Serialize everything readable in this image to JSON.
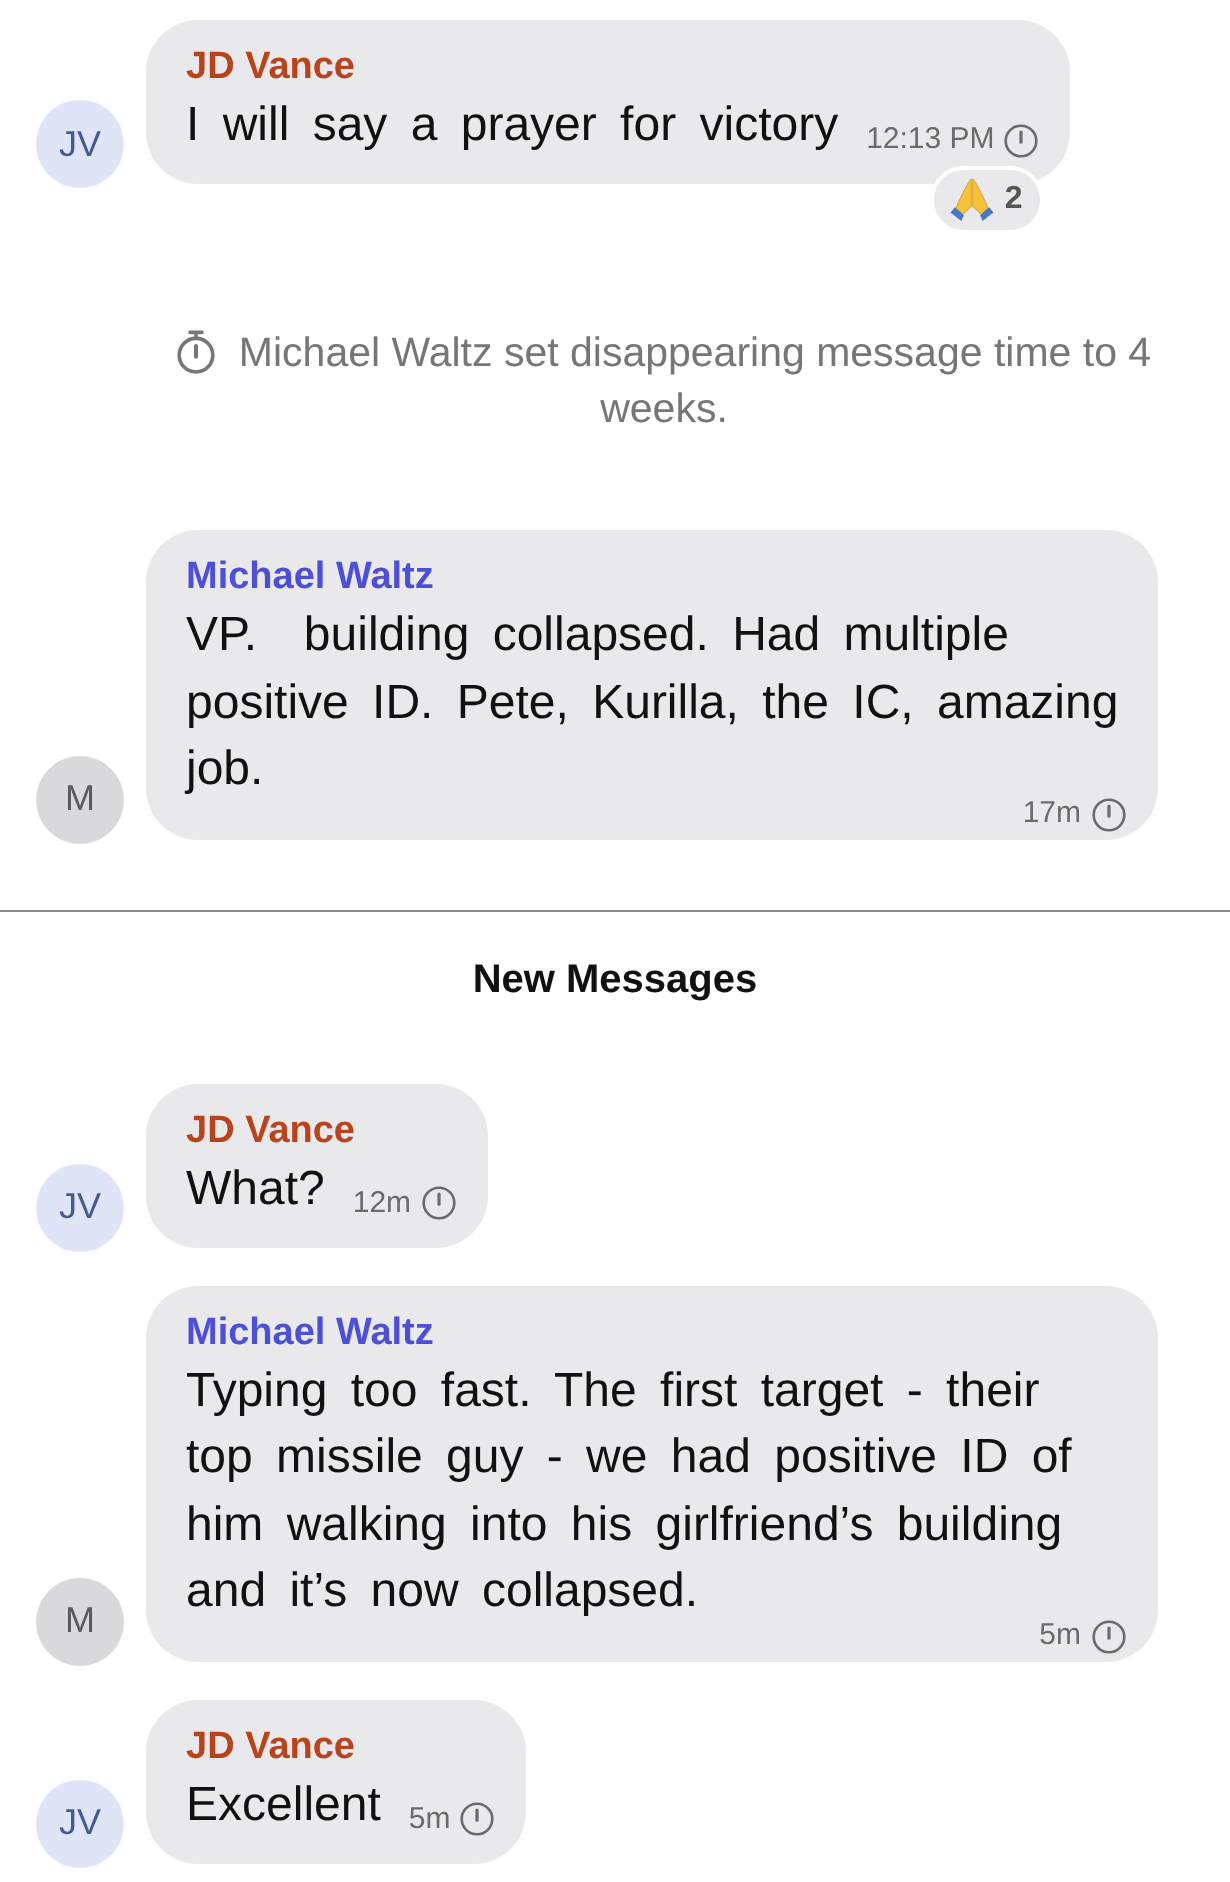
{
  "items": [
    {
      "kind": "message",
      "avatar": {
        "initials": "JV",
        "color": "#dfe5f6"
      },
      "sender": {
        "name": "JD Vance",
        "color": "#b8441e"
      },
      "text": "I will say a prayer for victory",
      "time": "12:13 PM",
      "reactions": [
        {
          "count": "2"
        }
      ]
    },
    {
      "kind": "system",
      "text": "Michael Waltz set disappearing message time to 4 weeks."
    },
    {
      "kind": "message",
      "avatar": {
        "initials": "M",
        "color": "#d9d9db"
      },
      "sender": {
        "name": "Michael Waltz",
        "color": "#4d4fd6"
      },
      "text": "VP.  building collapsed. Had multiple positive ID. Pete, Kurilla, the IC, amazing job.",
      "time": "17m"
    },
    {
      "kind": "divider",
      "label": "New Messages"
    },
    {
      "kind": "message",
      "avatar": {
        "initials": "JV",
        "color": "#dfe5f6"
      },
      "sender": {
        "name": "JD Vance",
        "color": "#b8441e"
      },
      "text": "What?",
      "time": "12m"
    },
    {
      "kind": "message",
      "avatar": {
        "initials": "M",
        "color": "#d9d9db"
      },
      "sender": {
        "name": "Michael Waltz",
        "color": "#4d4fd6"
      },
      "text": "Typing too fast. The first target - their top missile guy - we had positive ID of him walking into his girlfriend’s building and it’s now collapsed.",
      "time": "5m"
    },
    {
      "kind": "message",
      "avatar": {
        "initials": "JV",
        "color": "#dfe5f6"
      },
      "sender": {
        "name": "JD Vance",
        "color": "#b8441e"
      },
      "text": "Excellent",
      "time": "5m"
    }
  ]
}
